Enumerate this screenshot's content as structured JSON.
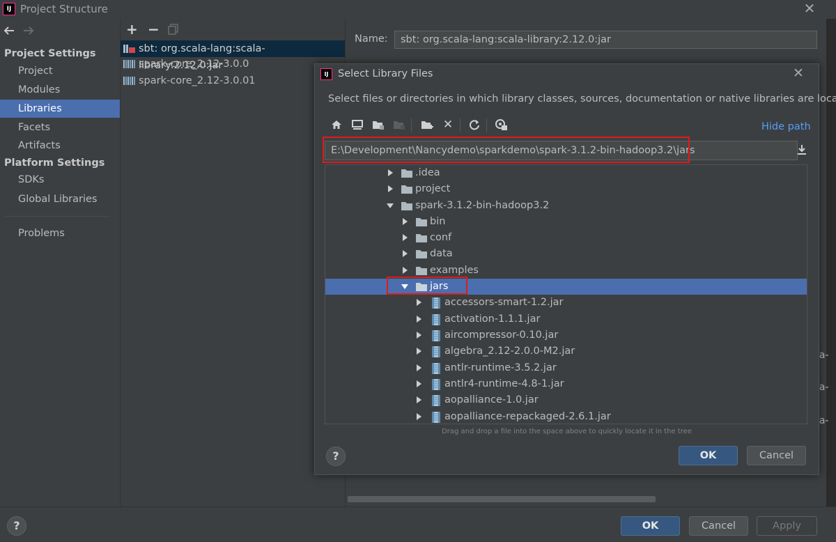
{
  "window": {
    "title": "Project Structure",
    "logo_text": "IJ",
    "close_glyph": "✕"
  },
  "nav": {
    "back_icon": "arrow-left-icon",
    "forward_icon": "arrow-right-icon",
    "project_settings_header": "Project Settings",
    "project_settings_items": [
      "Project",
      "Modules",
      "Libraries",
      "Facets",
      "Artifacts"
    ],
    "platform_settings_header": "Platform Settings",
    "platform_settings_items": [
      "SDKs",
      "Global Libraries"
    ],
    "problems": "Problems",
    "selected": "Libraries"
  },
  "libraries": {
    "toolbar": {
      "add": "+",
      "remove": "−"
    },
    "items": [
      "sbt: org.scala-lang:scala-library:2.12.0:jar",
      "spark-core_2.12-3.0.0",
      "spark-core_2.12-3.0.01"
    ],
    "selected_index": 0
  },
  "details": {
    "name_label": "Name:",
    "name_value": "sbt: org.scala-lang:scala-library:2.12.0:jar",
    "edge_texts": [
      "la-",
      "la-",
      "la-"
    ]
  },
  "dialog": {
    "title": "Select Library Files",
    "logo_text": "IJ",
    "close_glyph": "✕",
    "description": "Select files or directories in which library classes, sources, documentation or native libraries are located",
    "toolbar_icons": [
      "home-icon",
      "desktop-icon",
      "project-folder-icon",
      "module-folder-icon",
      "new-folder-icon",
      "delete-icon",
      "refresh-icon",
      "show-hidden-icon"
    ],
    "delete_glyph": "✕",
    "hide_path": "Hide path",
    "path": "E:\\Development\\Nancydemo\\sparkdemo\\spark-3.1.2-bin-hadoop3.2\\jars",
    "tree": {
      "folders_level1": [
        ".idea",
        "project"
      ],
      "open_folder": "spark-3.1.2-bin-hadoop3.2",
      "folders_level2": [
        "bin",
        "conf",
        "data",
        "examples"
      ],
      "selected_folder": "jars",
      "jars": [
        "accessors-smart-1.2.jar",
        "activation-1.1.1.jar",
        "aircompressor-0.10.jar",
        "algebra_2.12-2.0.0-M2.jar",
        "antlr-runtime-3.5.2.jar",
        "antlr4-runtime-4.8-1.jar",
        "aopalliance-1.0.jar",
        "aopalliance-repackaged-2.6.1.jar"
      ]
    },
    "drag_hint": "Drag and drop a file into the space above to quickly locate it in the tree",
    "help": "?",
    "ok": "OK",
    "cancel": "Cancel"
  },
  "footer": {
    "help": "?",
    "ok": "OK",
    "cancel": "Cancel",
    "apply": "Apply"
  },
  "colors": {
    "background": "#3c3f41",
    "selection": "#4b6eaf",
    "link": "#589df6",
    "highlight_border": "#e01b1b",
    "primary_button": "#365880"
  }
}
